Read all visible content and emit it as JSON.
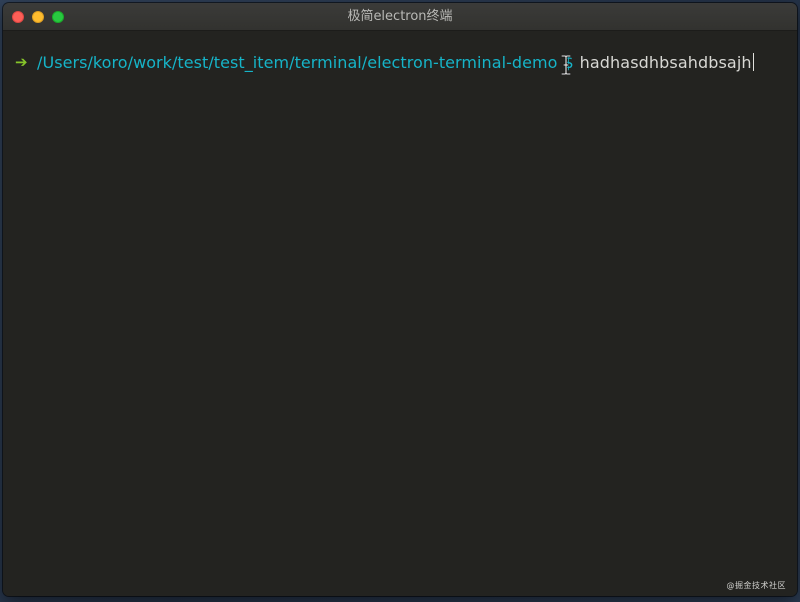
{
  "window": {
    "title": "极简electron终端"
  },
  "terminal": {
    "prompt_arrow": "➔",
    "cwd": "/Users/koro/work/test/test_item/terminal/electron-terminal-demo",
    "prompt_symbol": "$",
    "input": "hadhasdhbsahdbsajh"
  },
  "watermark": {
    "text": "@掘金技术社区"
  },
  "colors": {
    "terminal_bg": "#232320",
    "path": "#16b4c8",
    "arrow": "#86c42a",
    "input_text": "#d8d8d4"
  },
  "icons": {
    "close": "close-traffic-light-icon",
    "minimize": "minimize-traffic-light-icon",
    "zoom": "zoom-traffic-light-icon",
    "cursor": "ibeam-cursor-icon"
  }
}
